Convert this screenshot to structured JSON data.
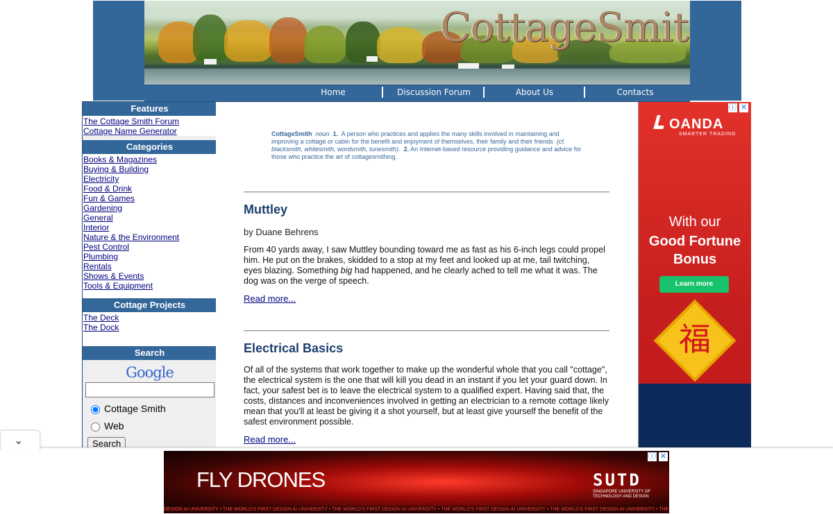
{
  "header": {
    "logo": "CottageSmith",
    "nav": [
      "Home",
      "Discussion Forum",
      "About Us",
      "Contacts"
    ]
  },
  "sidebar": {
    "features_title": "Features",
    "features": [
      "The Cottage Smith Forum",
      "Cottage Name Generator"
    ],
    "categories_title": "Categories",
    "categories": [
      "Books & Magazines",
      "Buying & Building",
      "Electricity",
      "Food & Drink",
      "Fun & Games",
      "Gardening",
      "General",
      "Interior",
      "Nature & the Environment",
      "Pest Control",
      "Plumbing",
      "Rentals",
      "Shows & Events",
      "Tools & Equipment"
    ],
    "projects_title": "Cottage Projects",
    "projects": [
      "The Deck",
      "The Dock"
    ],
    "search_title": "Search",
    "google": "Google",
    "radio_site": "Cottage Smith",
    "radio_web": "Web",
    "search_button": "Search"
  },
  "main": {
    "definition": {
      "term": "CottageSmith",
      "pos": "noun",
      "n1": "1.",
      "text1": "A person who practices and applies the many skills involved in maintaining and improving a cottage or cabin for the benefit and enjoyment of themselves, their family and their friends",
      "cf": "(cf. blacksmith, whitesmith, wordsmith, tunesmith).",
      "n2": "2.",
      "text2": "An Internet-based resource providing guidance and advice for those who practice the art of cottagesmithing."
    },
    "articles": [
      {
        "title": "Muttley",
        "byline": "by Duane Behrens",
        "body_before": "From 40 yards away, I saw Muttley bounding toward me as fast as his 6-inch legs could propel him. He put on the brakes, skidded to a stop at my feet and looked up at me, tail twitching, eyes blazing. Something ",
        "body_em": "big",
        "body_after": " had happened, and he clearly ached to tell me what it was. The dog was on the verge of speech.",
        "read_more": "Read more..."
      },
      {
        "title": "Electrical Basics",
        "body": "Of all of the systems that work together to make up the wonderful whole that you call \"cottage\", the electrical system is the one that will kill you dead in an instant if you let your guard down. In fact, your safest bet is to leave the electrical system to a qualified expert. Having said that, the costs, distances and inconveniences involved in getting an electrician to a remote cottage likely mean that you'll at least be giving it a shot yourself, but at least give yourself the benefit of the safest environment possible.",
        "read_more": "Read more..."
      }
    ]
  },
  "ad_right": {
    "brand": "OANDA",
    "tagline": "SMARTER TRADING",
    "line1": "With our",
    "line2": "Good Fortune Bonus",
    "button": "Learn more",
    "fu": "福",
    "close": "✕",
    "info": "ⓘ"
  },
  "ad_bottom": {
    "headline": "FLY DRONES",
    "logo": "SUTD",
    "sub": "SINGAPORE UNIVERSITY OF TECHNOLOGY AND DESIGN",
    "ticker": "DESIGN AI UNIVERSITY  •  THE WORLD'S FIRST DESIGN AI UNIVERSITY  •  THE WORLD'S FIRST DESIGN AI UNIVERSITY  •  THE WORLD'S FIRST DESIGN AI UNIVERSITY  •  THE WORLD'S FIRST DESIGN AI UNIVERSITY  •  THE",
    "close": "✕",
    "info": "ⓘ"
  },
  "colors": {
    "brand_blue": "#336699",
    "link": "#000080",
    "title": "#1c3f6e",
    "oanda_red": "#e3312a",
    "learn_green": "#18c26a"
  },
  "icons": {
    "collapse": "chevron-down-icon"
  }
}
